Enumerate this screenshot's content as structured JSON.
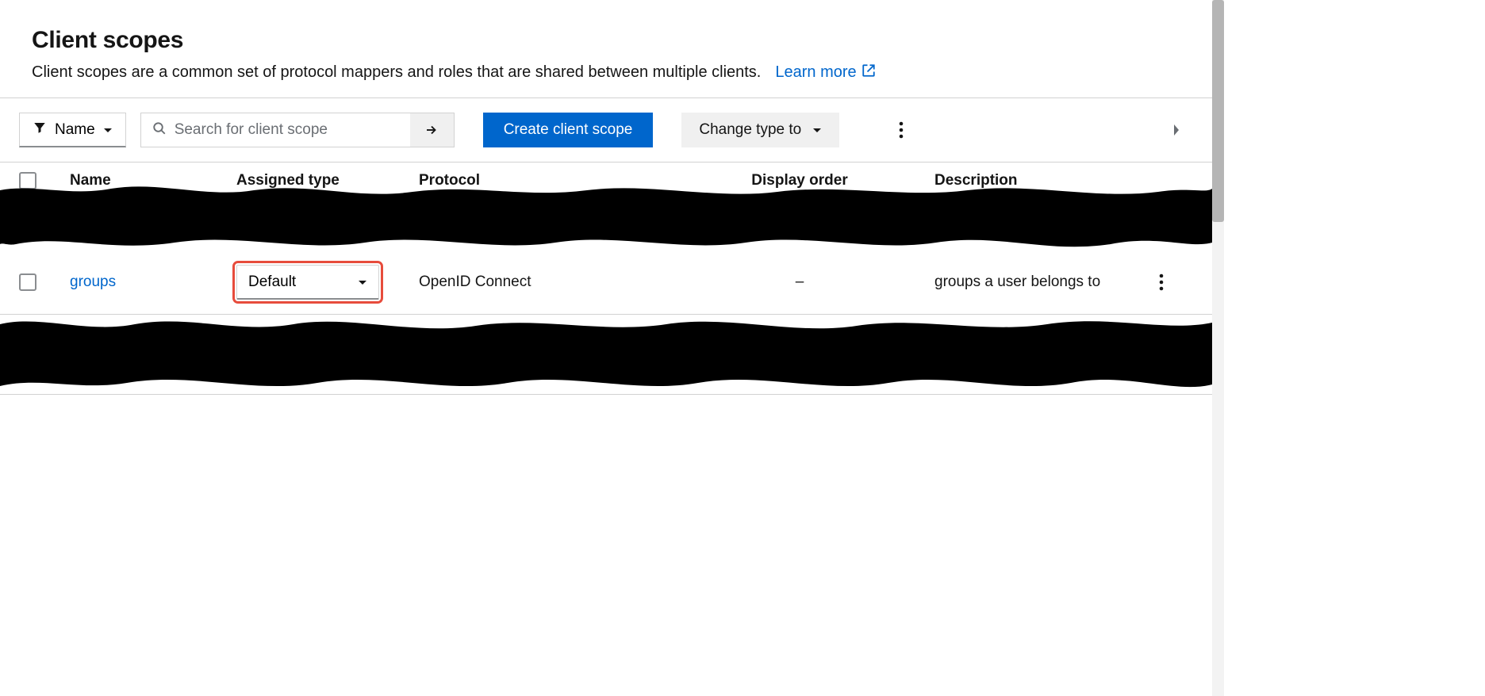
{
  "header": {
    "title": "Client scopes",
    "subtitle": "Client scopes are a common set of protocol mappers and roles that are shared between multiple clients.",
    "learn_more": "Learn more"
  },
  "toolbar": {
    "filter_label": "Name",
    "search_placeholder": "Search for client scope",
    "create_label": "Create client scope",
    "change_type_label": "Change type to"
  },
  "table": {
    "columns": {
      "name": "Name",
      "assigned_type": "Assigned type",
      "protocol": "Protocol",
      "display_order": "Display order",
      "description": "Description"
    },
    "row": {
      "name": "groups",
      "assigned_type": "Default",
      "protocol": "OpenID Connect",
      "display_order": "–",
      "description": "groups a user belongs to"
    }
  }
}
